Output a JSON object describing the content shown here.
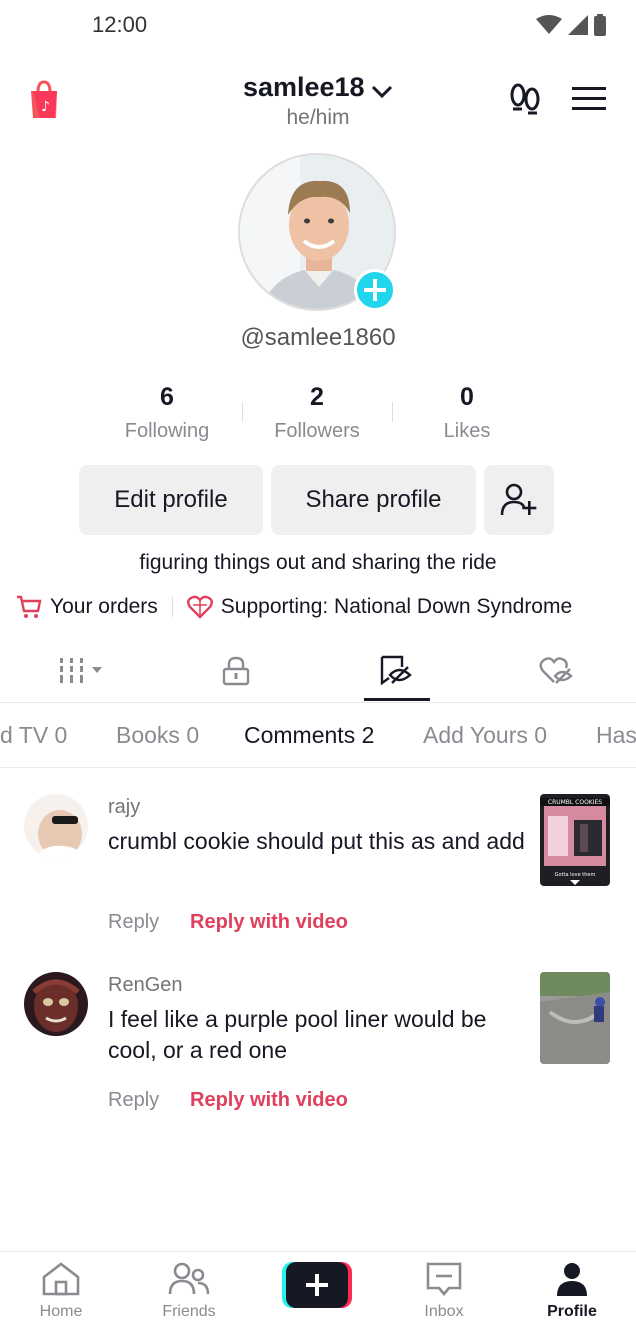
{
  "status_bar": {
    "time": "12:00"
  },
  "profile": {
    "username": "samlee18",
    "pronouns": "he/him",
    "handle": "@samlee1860",
    "bio": "figuring things out and sharing the ride"
  },
  "stats": [
    {
      "value": "6",
      "label": "Following"
    },
    {
      "value": "2",
      "label": "Followers"
    },
    {
      "value": "0",
      "label": "Likes"
    }
  ],
  "actions": {
    "edit": "Edit profile",
    "share": "Share profile"
  },
  "links": {
    "orders": "Your orders",
    "supporting": "Supporting: National Down Syndrome"
  },
  "sub_tabs": [
    {
      "label": "d TV  0"
    },
    {
      "label": "Books 0"
    },
    {
      "label": "Comments 2",
      "active": true
    },
    {
      "label": "Add Yours 0"
    },
    {
      "label": "Has"
    }
  ],
  "comments": [
    {
      "name": "rajy",
      "text": "crumbl cookie should put this as and add",
      "reply": "Reply",
      "reply_video": "Reply with video",
      "thumb_text": "CRUMBL COOKIES",
      "thumb_caption": "Gotta love them"
    },
    {
      "name": "RenGen",
      "text": "I feel like a purple pool liner would be cool, or a red one",
      "reply": "Reply",
      "reply_video": "Reply with video"
    }
  ],
  "bottom_nav": {
    "home": "Home",
    "friends": "Friends",
    "inbox": "Inbox",
    "profile": "Profile"
  },
  "colors": {
    "accent": "#e0405c",
    "badge": "#20d5ec",
    "text": "#161823",
    "muted": "#8a8b91"
  }
}
